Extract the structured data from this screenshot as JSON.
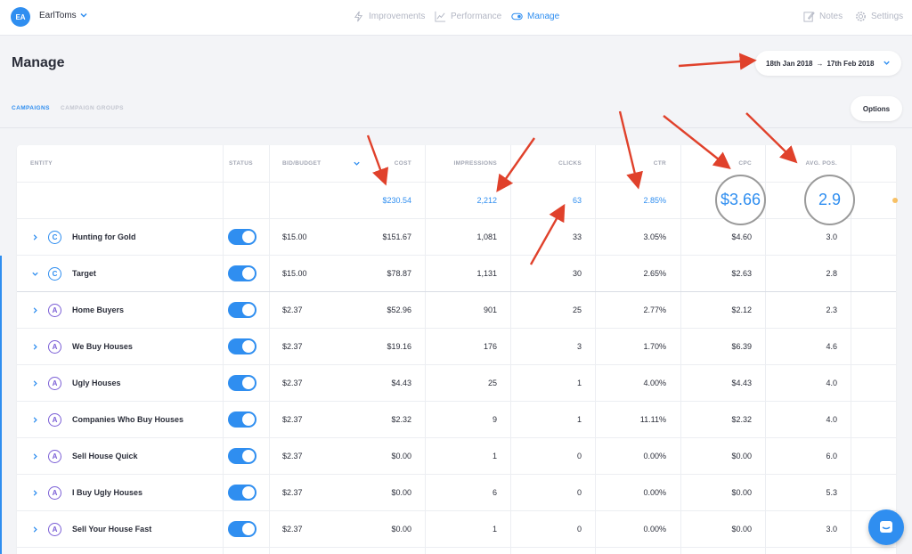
{
  "topnav": {
    "avatar": "EA",
    "user": "EarlToms",
    "items": [
      {
        "label": "Improvements",
        "icon": "lightning-icon"
      },
      {
        "label": "Performance",
        "icon": "chart-icon"
      },
      {
        "label": "Manage",
        "icon": "toggle-icon"
      },
      {
        "label": "Notes",
        "icon": "edit-icon"
      },
      {
        "label": "Settings",
        "icon": "gear-icon"
      }
    ]
  },
  "page": {
    "title": "Manage",
    "date_start": "18th Jan 2018",
    "date_end": "17th Feb 2018",
    "date_arrow": "→",
    "tabs": [
      "CAMPAIGNS",
      "CAMPAIGN GROUPS"
    ],
    "options_label": "Options"
  },
  "table": {
    "headers": [
      "ENTITY",
      "STATUS",
      "BID/BUDGET",
      "COST",
      "IMPRESSIONS",
      "CLICKS",
      "CTR",
      "CPC",
      "AVG. POS."
    ],
    "totals": {
      "cost": "$230.54",
      "impressions": "2,212",
      "clicks": "63",
      "ctr": "2.85%",
      "cpc": "$3.66",
      "pos": "2.9"
    },
    "rows": [
      {
        "type": "C",
        "name": "Hunting for Gold",
        "status": "on",
        "budget": "$15.00",
        "cost": "$151.67",
        "impressions": "1,081",
        "clicks": "33",
        "ctr": "3.05%",
        "cpc": "$4.60",
        "pos": "3.0"
      },
      {
        "type": "C",
        "name": "Target",
        "status": "on",
        "budget": "$15.00",
        "cost": "$78.87",
        "impressions": "1,131",
        "clicks": "30",
        "ctr": "2.65%",
        "cpc": "$2.63",
        "pos": "2.8"
      },
      {
        "type": "A",
        "name": "Home Buyers",
        "status": "on",
        "budget": "$2.37",
        "cost": "$52.96",
        "impressions": "901",
        "clicks": "25",
        "ctr": "2.77%",
        "cpc": "$2.12",
        "pos": "2.3"
      },
      {
        "type": "A",
        "name": "We Buy Houses",
        "status": "on",
        "budget": "$2.37",
        "cost": "$19.16",
        "impressions": "176",
        "clicks": "3",
        "ctr": "1.70%",
        "cpc": "$6.39",
        "pos": "4.6"
      },
      {
        "type": "A",
        "name": "Ugly Houses",
        "status": "on",
        "budget": "$2.37",
        "cost": "$4.43",
        "impressions": "25",
        "clicks": "1",
        "ctr": "4.00%",
        "cpc": "$4.43",
        "pos": "4.0"
      },
      {
        "type": "A",
        "name": "Companies Who Buy Houses",
        "status": "on",
        "budget": "$2.37",
        "cost": "$2.32",
        "impressions": "9",
        "clicks": "1",
        "ctr": "11.11%",
        "cpc": "$2.32",
        "pos": "4.0"
      },
      {
        "type": "A",
        "name": "Sell House Quick",
        "status": "on",
        "budget": "$2.37",
        "cost": "$0.00",
        "impressions": "1",
        "clicks": "0",
        "ctr": "0.00%",
        "cpc": "$0.00",
        "pos": "6.0"
      },
      {
        "type": "A",
        "name": "I Buy Ugly Houses",
        "status": "on",
        "budget": "$2.37",
        "cost": "$0.00",
        "impressions": "6",
        "clicks": "0",
        "ctr": "0.00%",
        "cpc": "$0.00",
        "pos": "5.3"
      },
      {
        "type": "A",
        "name": "Sell Your House Fast",
        "status": "on",
        "budget": "$2.37",
        "cost": "$0.00",
        "impressions": "1",
        "clicks": "0",
        "ctr": "0.00%",
        "cpc": "$0.00",
        "pos": "3.0"
      }
    ]
  },
  "colors": {
    "accent": "#2f8ef0",
    "ad_badge": "#7b5fd6",
    "annotation_arrow": "#e0412b",
    "annotation_circle": "#9a9a9a"
  },
  "overlay": {
    "chat_icon": "chat-icon"
  }
}
